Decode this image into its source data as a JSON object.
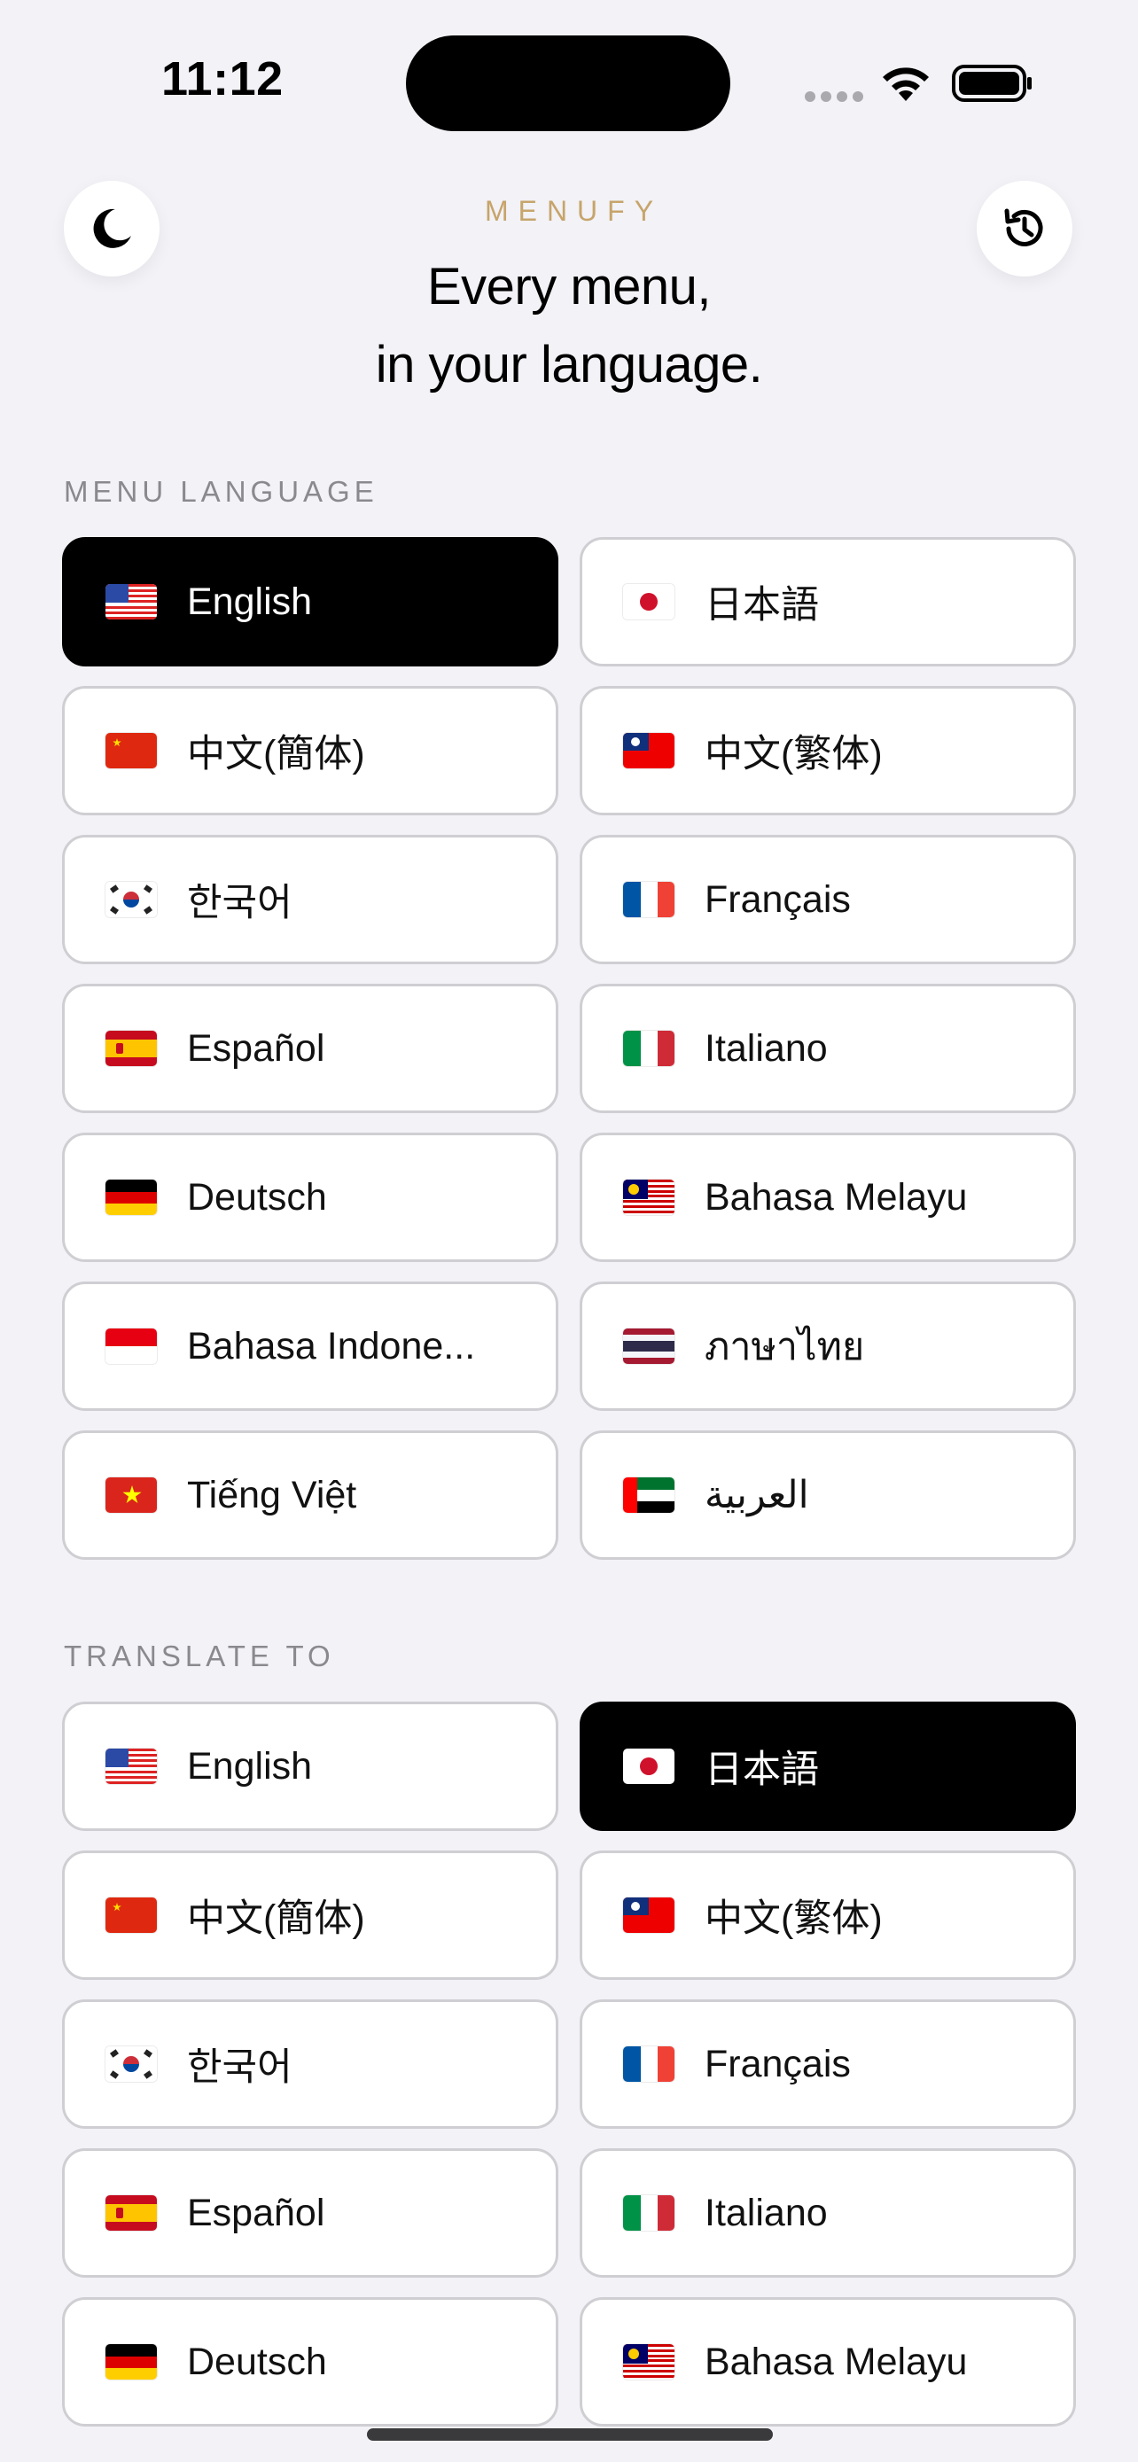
{
  "status_bar": {
    "time": "11:12"
  },
  "header": {
    "brand": "MENUFY",
    "headline_line1": "Every menu,",
    "headline_line2": "in your language.",
    "dark_mode_icon": "moon-icon",
    "history_icon": "history-icon"
  },
  "menu_language": {
    "label": "MENU LANGUAGE",
    "selected": "English",
    "items": [
      {
        "label": "English",
        "flag": "us"
      },
      {
        "label": "日本語",
        "flag": "jp"
      },
      {
        "label": "中文(簡体)",
        "flag": "cn"
      },
      {
        "label": "中文(繁体)",
        "flag": "tw"
      },
      {
        "label": "한국어",
        "flag": "kr"
      },
      {
        "label": "Français",
        "flag": "fr"
      },
      {
        "label": "Español",
        "flag": "es"
      },
      {
        "label": "Italiano",
        "flag": "it"
      },
      {
        "label": "Deutsch",
        "flag": "de"
      },
      {
        "label": "Bahasa Melayu",
        "flag": "my"
      },
      {
        "label": "Bahasa Indone...",
        "flag": "id"
      },
      {
        "label": "ภาษาไทย",
        "flag": "th"
      },
      {
        "label": "Tiếng Việt",
        "flag": "vn"
      },
      {
        "label": "العربية",
        "flag": "ae"
      }
    ]
  },
  "translate_to": {
    "label": "TRANSLATE TO",
    "selected": "日本語",
    "items": [
      {
        "label": "English",
        "flag": "us"
      },
      {
        "label": "日本語",
        "flag": "jp"
      },
      {
        "label": "中文(簡体)",
        "flag": "cn"
      },
      {
        "label": "中文(繁体)",
        "flag": "tw"
      },
      {
        "label": "한국어",
        "flag": "kr"
      },
      {
        "label": "Français",
        "flag": "fr"
      },
      {
        "label": "Español",
        "flag": "es"
      },
      {
        "label": "Italiano",
        "flag": "it"
      },
      {
        "label": "Deutsch",
        "flag": "de"
      },
      {
        "label": "Bahasa Melayu",
        "flag": "my"
      }
    ]
  },
  "colors": {
    "background": "#f2f2f7",
    "brand": "#c7a46a",
    "selected_bg": "#000000",
    "button_border": "#cfcfd3",
    "section_label": "#8a8a8e"
  }
}
